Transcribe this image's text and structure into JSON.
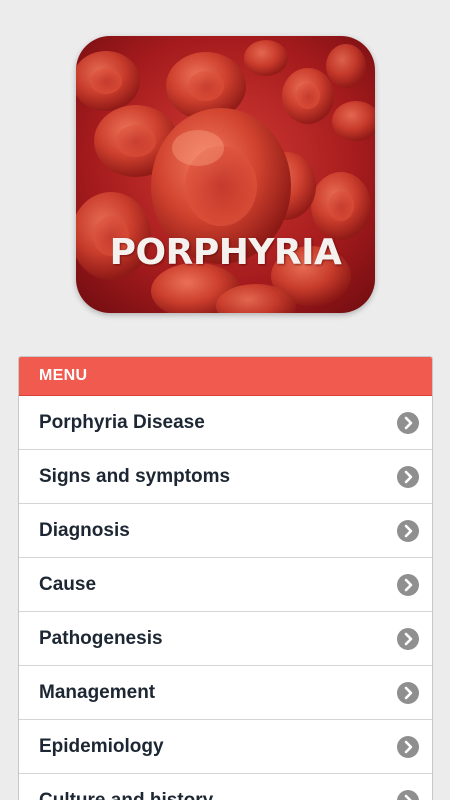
{
  "logo": {
    "title": "PORPHYRIA"
  },
  "menu": {
    "header": "MENU",
    "items": [
      {
        "label": "Porphyria Disease"
      },
      {
        "label": "Signs and symptoms"
      },
      {
        "label": "Diagnosis"
      },
      {
        "label": "Cause"
      },
      {
        "label": "Pathogenesis"
      },
      {
        "label": "Management"
      },
      {
        "label": "Epidemiology"
      },
      {
        "label": "Culture and history"
      }
    ]
  },
  "colors": {
    "menu_header_bg": "#f15a4f",
    "background": "#ececec",
    "chevron_circle": "#8f8f8f",
    "item_text": "#1d2733"
  },
  "icons": {
    "item_chevron": "chevron-right-circle-icon",
    "logo": "red-blood-cells-logo"
  }
}
